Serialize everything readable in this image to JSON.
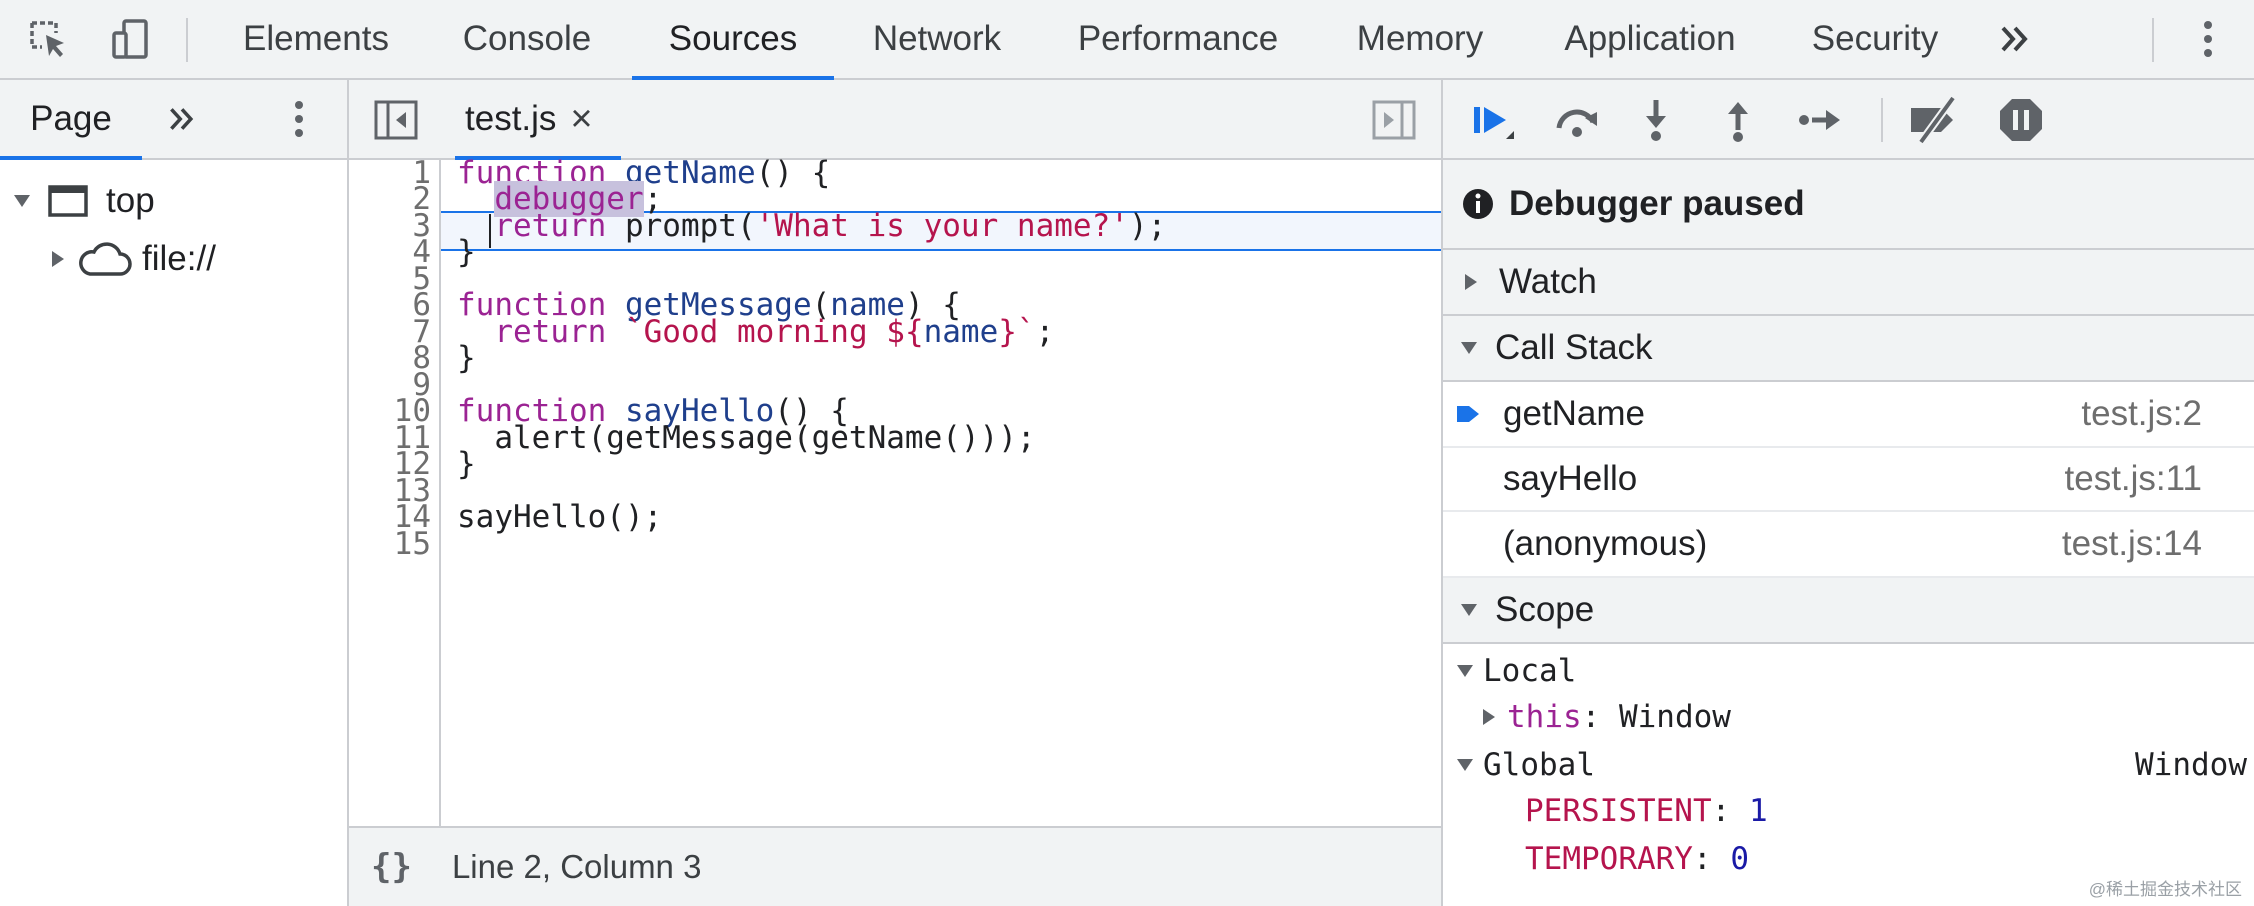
{
  "tabs": [
    "Elements",
    "Console",
    "Sources",
    "Network",
    "Performance",
    "Memory",
    "Application",
    "Security"
  ],
  "icons": {
    "inspect": "inspect-element-icon",
    "device": "device-toolbar-icon",
    "more_tabs": "double-chevron-icon",
    "menu": "vertical-dots-icon"
  },
  "navigator": {
    "tab_label": "Page",
    "tree": [
      {
        "label": "top",
        "icon": "frame-icon"
      },
      {
        "label": "file://",
        "icon": "cloud-icon"
      }
    ]
  },
  "editor": {
    "file_tab": "test.js",
    "close_glyph": "×",
    "line_numbers": [
      "1",
      "2",
      "3",
      "4",
      "5",
      "6",
      "7",
      "8",
      "9",
      "10",
      "11",
      "12",
      "13",
      "14",
      "15"
    ],
    "code": {
      "l1_kw": "function",
      "l1_fn": "getName",
      "l1_rest": "() {",
      "l2_kw": "debugger",
      "l2_rest": ";",
      "l3_kw": "return",
      "l3_mid": " prompt(",
      "l3_str": "'What is your name?'",
      "l3_end": ");",
      "l4": "}",
      "l6_kw": "function",
      "l6_fn": "getMessage",
      "l6_p1": "(",
      "l6_param": "name",
      "l6_p2": ") {",
      "l7_kw": "return",
      "l7_str1": "`Good morning ${",
      "l7_var": "name",
      "l7_str2": "}`",
      "l7_end": ";",
      "l8": "}",
      "l10_kw": "function",
      "l10_fn": "sayHello",
      "l10_rest": "() {",
      "l11": "  alert(getMessage(getName()));",
      "l12": "}",
      "l14": "sayHello();"
    },
    "status_braces": "{}",
    "status_text": "Line 2, Column 3"
  },
  "debugger": {
    "paused_text": "Debugger paused",
    "watch_label": "Watch",
    "callstack_label": "Call Stack",
    "frames": [
      {
        "name": "getName",
        "location": "test.js:2"
      },
      {
        "name": "sayHello",
        "location": "test.js:11"
      },
      {
        "name": "(anonymous)",
        "location": "test.js:14"
      }
    ],
    "scope_label": "Scope",
    "local_label": "Local",
    "this_key": "this",
    "this_value": "Window",
    "global_label": "Global",
    "global_value": "Window",
    "persistent_key": "PERSISTENT",
    "persistent_value": "1",
    "temporary_key": "TEMPORARY",
    "temporary_value": "0"
  },
  "watermark": "@稀土掘金技术社区",
  "colors": {
    "accent": "#1a73e8",
    "keyword": "#9b2393",
    "string": "#b5144d",
    "function_name": "#1f3f8c",
    "number": "#1a1aa6"
  }
}
